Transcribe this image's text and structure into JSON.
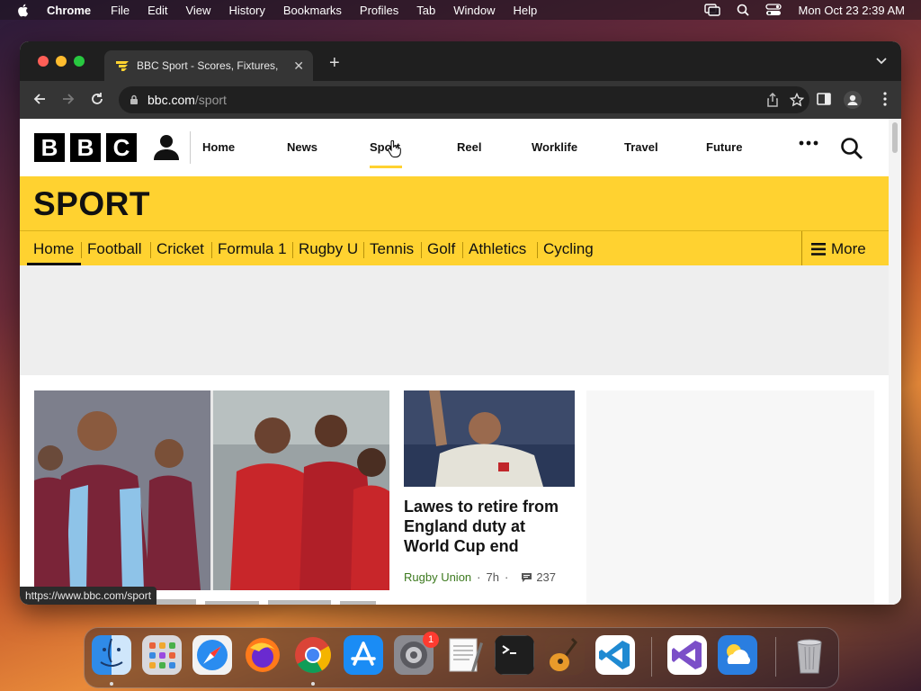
{
  "menubar": {
    "app_name": "Chrome",
    "items": [
      "File",
      "Edit",
      "View",
      "History",
      "Bookmarks",
      "Profiles",
      "Tab",
      "Window",
      "Help"
    ],
    "datetime": "Mon Oct 23  2:39 AM"
  },
  "browser": {
    "tab_title": "BBC Sport - Scores, Fixtures,",
    "new_tab_label": "+",
    "url_host": "bbc.com",
    "url_path": "/sport",
    "status_url": "https://www.bbc.com/sport"
  },
  "bbc": {
    "logo_letters": [
      "B",
      "B",
      "C"
    ],
    "nav": [
      "Home",
      "News",
      "Sport",
      "Reel",
      "Worklife",
      "Travel",
      "Future"
    ]
  },
  "sport": {
    "title": "SPORT",
    "nav": [
      "Home",
      "Football",
      "Cricket",
      "Formula 1",
      "Rugby U",
      "Tennis",
      "Golf",
      "Athletics",
      "Cycling"
    ],
    "more_label": "More"
  },
  "story": {
    "headline": "Lawes to retire from England duty at World Cup end",
    "topic": "Rugby Union",
    "age": "7h",
    "comments": "237"
  },
  "dock": {
    "apps": [
      "finder",
      "launchpad",
      "safari",
      "firefox",
      "chrome",
      "app-store",
      "system-settings",
      "textedit",
      "terminal",
      "garageband",
      "vscode",
      "visual-studio",
      "weather",
      "trash"
    ],
    "settings_badge": "1"
  },
  "colors": {
    "bbc_sport_yellow": "#ffd230",
    "topic_green": "#3d7a1f"
  }
}
